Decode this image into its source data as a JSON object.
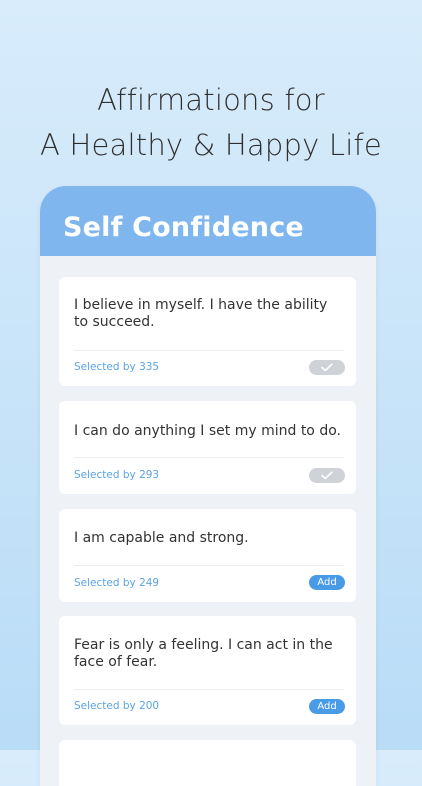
{
  "hero": {
    "line1": "Affirmations for",
    "line2": "A Healthy & Happy Life"
  },
  "screen": {
    "title": "Self Confidence"
  },
  "cards": [
    {
      "text": "I believe in myself. I have the ability to succeed.",
      "selected": "Selected by 335",
      "state": "checked",
      "icon": "check-icon"
    },
    {
      "text": "I can do anything I set my mind to do.",
      "selected": "Selected by 293",
      "state": "checked",
      "icon": "check-icon"
    },
    {
      "text": "I am capable and strong.",
      "selected": "Selected by 249",
      "state": "add",
      "button_label": "Add"
    },
    {
      "text": "Fear is only a feeling. I can act in the face of fear.",
      "selected": "Selected by 200",
      "state": "add",
      "button_label": "Add"
    }
  ],
  "colors": {
    "header": "#7fb6ee",
    "accent": "#4a9be6",
    "selected_text": "#5aa3e6",
    "checked_pill": "#cfd2d6"
  }
}
